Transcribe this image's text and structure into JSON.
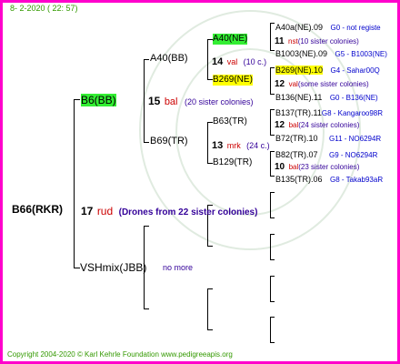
{
  "header": {
    "date": "8-  2-2020 ( 22:  57)"
  },
  "footer": {
    "text": "Copyright 2004-2020 © Karl Kehrle Foundation   www.pedigreeapis.org"
  },
  "root": {
    "id": "B66(RKR)",
    "num": "17",
    "mark": "rud",
    "note": "(Drones from 22 sister colonies)"
  },
  "queen_line": {
    "id": "B6(BB)",
    "num": "15",
    "mark": "bal",
    "note": "(20 sister colonies)"
  },
  "drone_line": {
    "id": "VSHmix(JBB)",
    "note": "no more"
  },
  "gen2": [
    {
      "id": "A40(BB)",
      "num": "14",
      "mark": "val",
      "note": "(10 c.)"
    },
    {
      "id": "B69(TR)",
      "num": "13",
      "mark": "mrk",
      "note": "(24 c.)"
    }
  ],
  "gen3": [
    {
      "id": "A40(NE)",
      "num": "11",
      "mark": "nst",
      "note": "(10 sister colonies)"
    },
    {
      "id": "B269(NE)",
      "num": "12",
      "mark": "val",
      "note": "(some sister colonies)"
    },
    {
      "id": "B63(TR)",
      "num": "12",
      "mark": "bal",
      "note": "(24 sister colonies)"
    },
    {
      "id": "B129(TR)",
      "num": "10",
      "mark": "bal",
      "note": "(23 sister colonies)"
    }
  ],
  "gen4": [
    {
      "id": "A40a(NE).09",
      "code": "G0 - not registe"
    },
    {
      "id": "B1003(NE).09",
      "code": "G5 - B1003(NE)"
    },
    {
      "id": "B269(NE).10",
      "code": "G4 - Sahar00Q"
    },
    {
      "id": "B136(NE).11",
      "code": "G0 - B136(NE)"
    },
    {
      "id": "B137(TR).11",
      "code": "G8 - Kangaroo98R"
    },
    {
      "id": "B72(TR).10",
      "code": "G11 - NO6294R"
    },
    {
      "id": "B82(TR).07",
      "code": "G9 - NO6294R"
    },
    {
      "id": "B135(TR).06",
      "code": "G8 - Takab93aR"
    }
  ],
  "colors": {
    "frame": "#ff00cc",
    "date": "#339900",
    "mark": "#cc0000",
    "note": "#330099",
    "code": "#0000cc",
    "green_hl": "#33ee33",
    "yellow_hl": "#ffff00",
    "lines": "#000000"
  }
}
